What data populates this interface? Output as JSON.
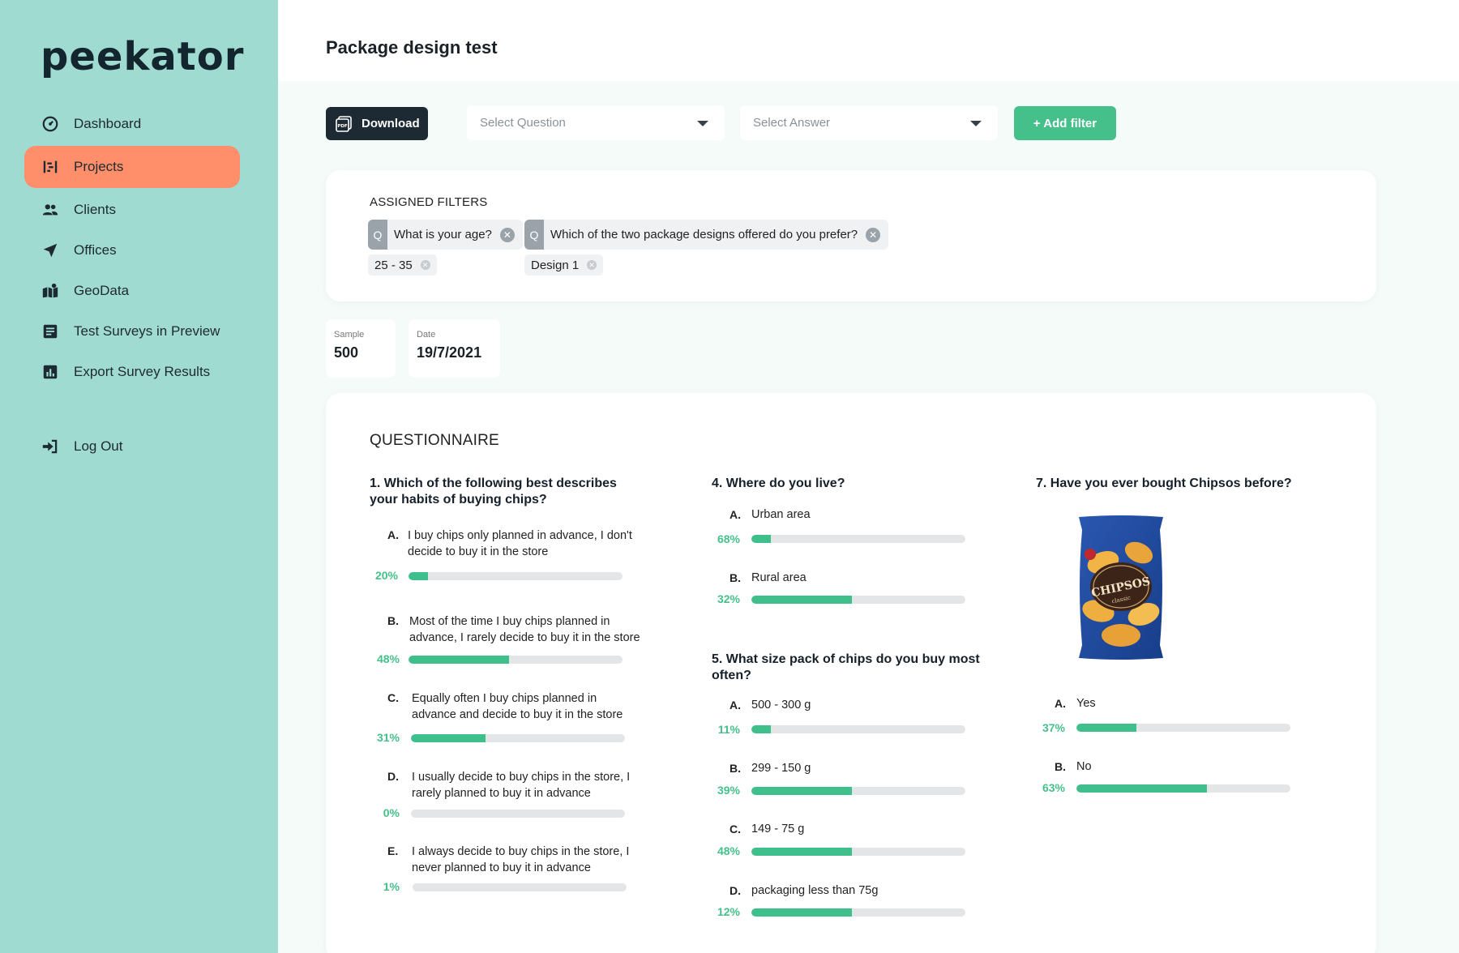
{
  "app": {
    "logo": "peekator"
  },
  "sidebar": {
    "items": [
      {
        "label": "Dashboard",
        "icon": "dashboard-icon"
      },
      {
        "label": "Projects",
        "icon": "projects-icon",
        "active": true
      },
      {
        "label": "Clients",
        "icon": "clients-icon"
      },
      {
        "label": "Offices",
        "icon": "offices-icon"
      },
      {
        "label": "GeoData",
        "icon": "geodata-icon"
      },
      {
        "label": "Test Surveys in Preview",
        "icon": "surveys-icon"
      },
      {
        "label": "Export  Survey Results",
        "icon": "export-icon"
      }
    ],
    "logout": "Log Out"
  },
  "header": {
    "title": "Package design test"
  },
  "toolbar": {
    "download_label": "Download",
    "select_question_placeholder": "Select Question",
    "select_answer_placeholder": "Select Answer",
    "add_filter_label": "+ Add filter"
  },
  "filters": {
    "title": "ASSIGNED FILTERS",
    "items": [
      {
        "prefix": "Q",
        "question": "What is your age?",
        "value": "25 - 35"
      },
      {
        "prefix": "Q",
        "question": "Which of the two package designs offered do you prefer?",
        "value": "Design 1"
      }
    ]
  },
  "stats": {
    "sample_label": "Sample",
    "sample_value": "500",
    "date_label": "Date",
    "date_value": "19/7/2021"
  },
  "questionnaire": {
    "title": "QUESTIONNAIRE",
    "q1": {
      "title_line1": "1. Which of the following best describes",
      "title_line2": "your habits of buying chips?",
      "options": [
        {
          "letter": "A.",
          "line1": "I buy chips only planned in advance, I don't",
          "line2": "decide to buy it in the store",
          "pct_label": "20%",
          "value": 0.09
        },
        {
          "letter": "B.",
          "line1": "Most of the time I buy chips planned in",
          "line2": "advance, I rarely decide to buy it in the store",
          "pct_label": "48%",
          "value": 0.47
        },
        {
          "letter": "C.",
          "line1": "Equally often I buy chips planned in",
          "line2": "advance and decide to buy it in the store",
          "pct_label": "31%",
          "value": 0.35
        },
        {
          "letter": "D.",
          "line1": "I usually decide to buy chips in the store, I",
          "line2": "rarely planned to buy it in advance",
          "pct_label": "0%",
          "value": 0.0
        },
        {
          "letter": "E.",
          "line1": "I always decide to buy chips in the store, I",
          "line2": "never planned to buy it in advance",
          "pct_label": "1%",
          "value": 0.0
        }
      ]
    },
    "q4": {
      "title_line1": "4. Where do you live?",
      "options": [
        {
          "letter": "A.",
          "text": "Urban area",
          "pct_label": "68%",
          "value": 0.09
        },
        {
          "letter": "B.",
          "text": "Rural area",
          "pct_label": "32%",
          "value": 0.47
        }
      ]
    },
    "q5": {
      "title_line1": "5. What size pack of chips do you buy most",
      "title_line2": "often?",
      "options": [
        {
          "letter": "A.",
          "text": "500 - 300 g",
          "pct_label": "11%",
          "value": 0.09
        },
        {
          "letter": "B.",
          "text": "299 - 150 g",
          "pct_label": "39%",
          "value": 0.47
        },
        {
          "letter": "C.",
          "text": "149 - 75 g",
          "pct_label": "48%",
          "value": 0.47
        },
        {
          "letter": "D.",
          "text": "packaging less than 75g",
          "pct_label": "12%",
          "value": 0.47
        }
      ]
    },
    "q7": {
      "title_line1": "7. Have you ever bought Chipsos before?",
      "product_image_text": "CHIPSOS",
      "product_image_subtext": "classic",
      "options": [
        {
          "letter": "A.",
          "text": "Yes",
          "pct_label": "37%",
          "value": 0.28
        },
        {
          "letter": "B.",
          "text": "No",
          "pct_label": "63%",
          "value": 0.61
        }
      ]
    }
  },
  "colors": {
    "sidebar": "#9fdbd0",
    "active": "#ff8f6a",
    "accent": "#45c08a",
    "dark": "#1d2a33"
  }
}
